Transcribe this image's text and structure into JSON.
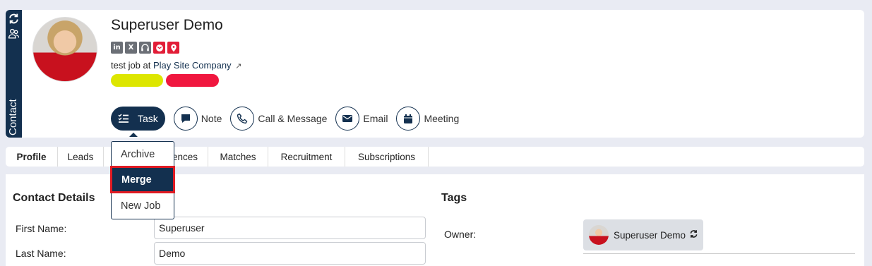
{
  "sidebar": {
    "label": "Contact",
    "icons": [
      "refresh-icon",
      "users-icon"
    ]
  },
  "contact": {
    "name": "Superuser Demo",
    "social_icons": [
      {
        "name": "linkedin-icon",
        "glyph": "in",
        "color": "#6b6f76"
      },
      {
        "name": "x-twitter-icon",
        "glyph": "𝕏",
        "color": "#6b6f76"
      },
      {
        "name": "headset-icon",
        "glyph": "🎧",
        "color": "#6b6f76"
      },
      {
        "name": "gmail-icon",
        "glyph": "@",
        "color": "#e21d37"
      },
      {
        "name": "location-pin-icon",
        "glyph": "⚲",
        "color": "#e21d37"
      }
    ],
    "job_prefix": "test job at",
    "company": "Play Site Company",
    "tag_colors": [
      "#dde600",
      "#f0173f"
    ]
  },
  "actions": [
    {
      "label": "Task",
      "icon": "task-list-icon",
      "active": true
    },
    {
      "label": "Note",
      "icon": "note-icon",
      "active": false
    },
    {
      "label": "Call & Message",
      "icon": "phone-icon",
      "active": false
    },
    {
      "label": "Email",
      "icon": "email-icon",
      "active": false
    },
    {
      "label": "Meeting",
      "icon": "calendar-icon",
      "active": false
    }
  ],
  "dropdown": {
    "items": [
      {
        "label": "Archive",
        "selected": false
      },
      {
        "label": "Merge",
        "selected": true
      },
      {
        "label": "New Job",
        "selected": false
      }
    ]
  },
  "tabs": [
    {
      "label": "Profile",
      "active": true
    },
    {
      "label": "Leads",
      "active": false
    },
    {
      "label": "ences",
      "active": false
    },
    {
      "label": "Matches",
      "active": false
    },
    {
      "label": "Recruitment",
      "active": false
    },
    {
      "label": "Subscriptions",
      "active": false
    }
  ],
  "contact_details": {
    "title": "Contact Details",
    "first_name_label": "First Name:",
    "first_name_value": "Superuser",
    "last_name_label": "Last Name:",
    "last_name_value": "Demo"
  },
  "tags": {
    "title": "Tags",
    "owner_label": "Owner:",
    "owner_name": "Superuser Demo"
  }
}
